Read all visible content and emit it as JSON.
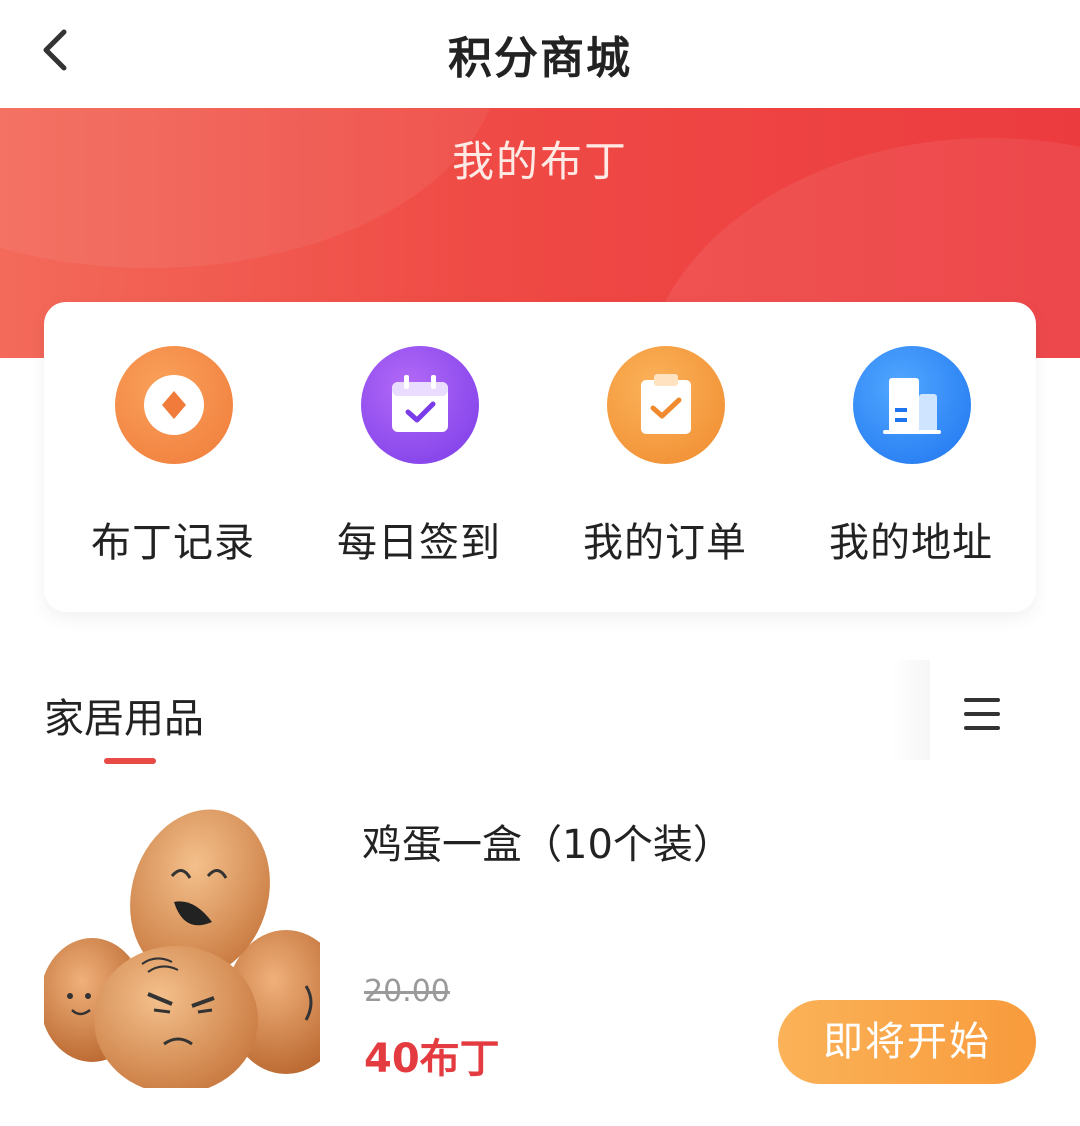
{
  "header": {
    "title": "积分商城"
  },
  "banner": {
    "title": "我的布丁"
  },
  "actions": [
    {
      "label": "布丁记录",
      "icon": "coin-icon",
      "color": "#f38446"
    },
    {
      "label": "每日签到",
      "icon": "calendar-check-icon",
      "color": "#8a47ee"
    },
    {
      "label": "我的订单",
      "icon": "clipboard-check-icon",
      "color": "#f5983d"
    },
    {
      "label": "我的地址",
      "icon": "building-icon",
      "color": "#2b84f4"
    }
  ],
  "category": {
    "label": "家居用品"
  },
  "product": {
    "name": "鸡蛋一盒（10个装）",
    "original_price": "20.00",
    "points_price": "40布丁",
    "button_label": "即将开始"
  },
  "colors": {
    "accent_red": "#e94a45",
    "button_orange": "#f9a649"
  }
}
